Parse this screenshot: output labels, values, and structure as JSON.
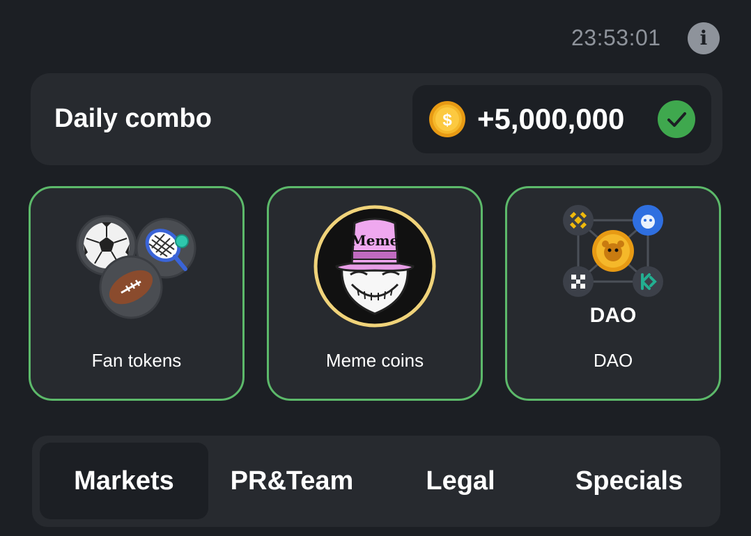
{
  "header": {
    "timer": "23:53:01",
    "info_icon": "info-icon"
  },
  "combo": {
    "title": "Daily combo",
    "reward": "+5,000,000",
    "coin_icon": "gold-coin-icon",
    "coin_symbol": "$",
    "status_icon": "green-check-icon"
  },
  "cards": [
    {
      "label": "Fan tokens",
      "icon": "sports-balls-icon"
    },
    {
      "label": "Meme coins",
      "icon": "meme-hat-icon",
      "hat_text": "Meme"
    },
    {
      "label": "DAO",
      "icon": "dao-network-icon",
      "badge_text": "DAO"
    }
  ],
  "tabs": [
    {
      "label": "Markets",
      "active": true
    },
    {
      "label": "PR&Team",
      "active": false
    },
    {
      "label": "Legal",
      "active": false
    },
    {
      "label": "Specials",
      "active": false
    }
  ],
  "colors": {
    "background": "#1c1f24",
    "surface": "#272a2f",
    "accent_green": "#5cb96a",
    "muted_text": "#8e939b",
    "coin_gold": "#f5b82a"
  }
}
